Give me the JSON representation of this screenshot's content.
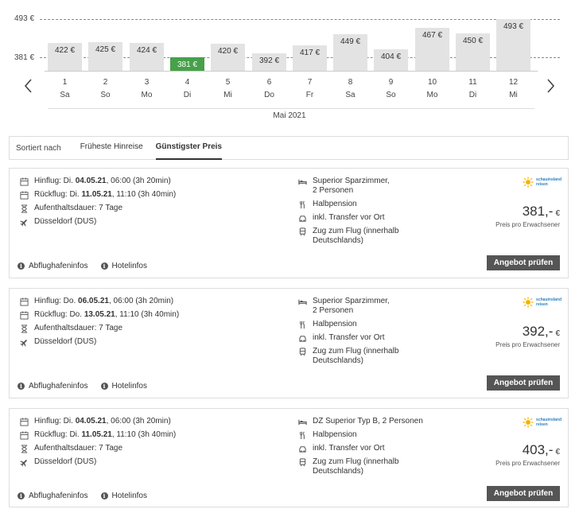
{
  "chart": {
    "ref_high_label": "493 €",
    "ref_low_label": "381 €",
    "ref_high_value": 493,
    "ref_low_value": 381,
    "month_label": "Mai 2021",
    "selected_day": "4",
    "days": [
      {
        "day": "1",
        "weekday": "Sa",
        "price": 422,
        "label": "422 €"
      },
      {
        "day": "2",
        "weekday": "So",
        "price": 425,
        "label": "425 €"
      },
      {
        "day": "3",
        "weekday": "Mo",
        "price": 424,
        "label": "424 €"
      },
      {
        "day": "4",
        "weekday": "Di",
        "price": 381,
        "label": "381 €"
      },
      {
        "day": "5",
        "weekday": "Mi",
        "price": 420,
        "label": "420 €"
      },
      {
        "day": "6",
        "weekday": "Do",
        "price": 392,
        "label": "392 €"
      },
      {
        "day": "7",
        "weekday": "Fr",
        "price": 417,
        "label": "417 €"
      },
      {
        "day": "8",
        "weekday": "Sa",
        "price": 449,
        "label": "449 €"
      },
      {
        "day": "9",
        "weekday": "So",
        "price": 404,
        "label": "404 €"
      },
      {
        "day": "10",
        "weekday": "Mo",
        "price": 467,
        "label": "467 €"
      },
      {
        "day": "11",
        "weekday": "Di",
        "price": 450,
        "label": "450 €"
      },
      {
        "day": "12",
        "weekday": "Mi",
        "price": 493,
        "label": "493 €"
      }
    ],
    "colors": {
      "bar": "#e3e3e3",
      "selected": "#47a04a"
    }
  },
  "sort": {
    "label": "Sortiert nach",
    "options": [
      "Früheste Hinreise",
      "Günstigster Preis"
    ],
    "active": "Günstigster Preis"
  },
  "offers": [
    {
      "outbound_prefix": "Hinflug: Di. ",
      "outbound_date": "04.05.21",
      "outbound_suffix": ", 06:00 (3h 20min)",
      "return_prefix": "Rückflug: Di. ",
      "return_date": "11.05.21",
      "return_suffix": ", 11:10 (3h 40min)",
      "stay": "Aufenthaltsdauer: 7 Tage",
      "airport": "Düsseldorf (DUS)",
      "room": "Superior Sparzimmer,\n2 Personen",
      "board": "Halbpension",
      "transfer": "inkl. Transfer vor Ort",
      "train": "Zug zum Flug (innerhalb\nDeutschlands)",
      "operator_logo_text": "schauinsland\nreisen",
      "price": "381,-",
      "currency": "€",
      "price_note": "Preis pro Erwachsener",
      "cta": "Angebot prüfen",
      "link_airport": "Abflughafeninfos",
      "link_hotel": "Hotelinfos"
    },
    {
      "outbound_prefix": "Hinflug: Do. ",
      "outbound_date": "06.05.21",
      "outbound_suffix": ", 06:00 (3h 20min)",
      "return_prefix": "Rückflug: Do. ",
      "return_date": "13.05.21",
      "return_suffix": ", 11:10 (3h 40min)",
      "stay": "Aufenthaltsdauer: 7 Tage",
      "airport": "Düsseldorf (DUS)",
      "room": "Superior Sparzimmer,\n2 Personen",
      "board": "Halbpension",
      "transfer": "inkl. Transfer vor Ort",
      "train": "Zug zum Flug (innerhalb\nDeutschlands)",
      "operator_logo_text": "schauinsland\nreisen",
      "price": "392,-",
      "currency": "€",
      "price_note": "Preis pro Erwachsener",
      "cta": "Angebot prüfen",
      "link_airport": "Abflughafeninfos",
      "link_hotel": "Hotelinfos"
    },
    {
      "outbound_prefix": "Hinflug: Di. ",
      "outbound_date": "04.05.21",
      "outbound_suffix": ", 06:00 (3h 20min)",
      "return_prefix": "Rückflug: Di. ",
      "return_date": "11.05.21",
      "return_suffix": ", 11:10 (3h 40min)",
      "stay": "Aufenthaltsdauer: 7 Tage",
      "airport": "Düsseldorf (DUS)",
      "room": "DZ Superior Typ B, 2 Personen",
      "board": "Halbpension",
      "transfer": "inkl. Transfer vor Ort",
      "train": "Zug zum Flug (innerhalb\nDeutschlands)",
      "operator_logo_text": "schauinsland\nreisen",
      "price": "403,-",
      "currency": "€",
      "price_note": "Preis pro Erwachsener",
      "cta": "Angebot prüfen",
      "link_airport": "Abflughafeninfos",
      "link_hotel": "Hotelinfos"
    }
  ]
}
